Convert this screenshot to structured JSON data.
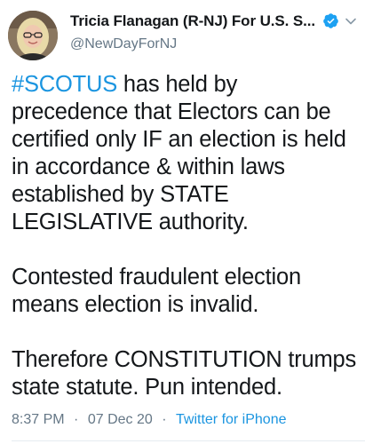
{
  "author": {
    "display_name": "Tricia Flanagan (R-NJ) For U.S. S...",
    "handle": "@NewDayForNJ",
    "verified": true,
    "avatar_icon": "profile-photo-avatar"
  },
  "tweet": {
    "hashtag": "#SCOTUS",
    "paragraph1_rest": " has held by precedence that Electors can be certified only IF an election is held in accordance & within laws established by STATE LEGISLATIVE authority.",
    "paragraph2": "Contested fraudulent election means election is invalid.",
    "paragraph3": "Therefore CONSTITUTION trumps state statute. Pun intended."
  },
  "meta": {
    "time": "8:37 PM",
    "separator": "·",
    "date": "07 Dec 20",
    "source": "Twitter for iPhone"
  },
  "colors": {
    "link": "#1b95e0",
    "text": "#14171a",
    "secondary": "#657786",
    "verified_badge": "#1da1f2"
  },
  "icons": {
    "verified": "verified-badge-icon",
    "more": "chevron-down-icon"
  }
}
